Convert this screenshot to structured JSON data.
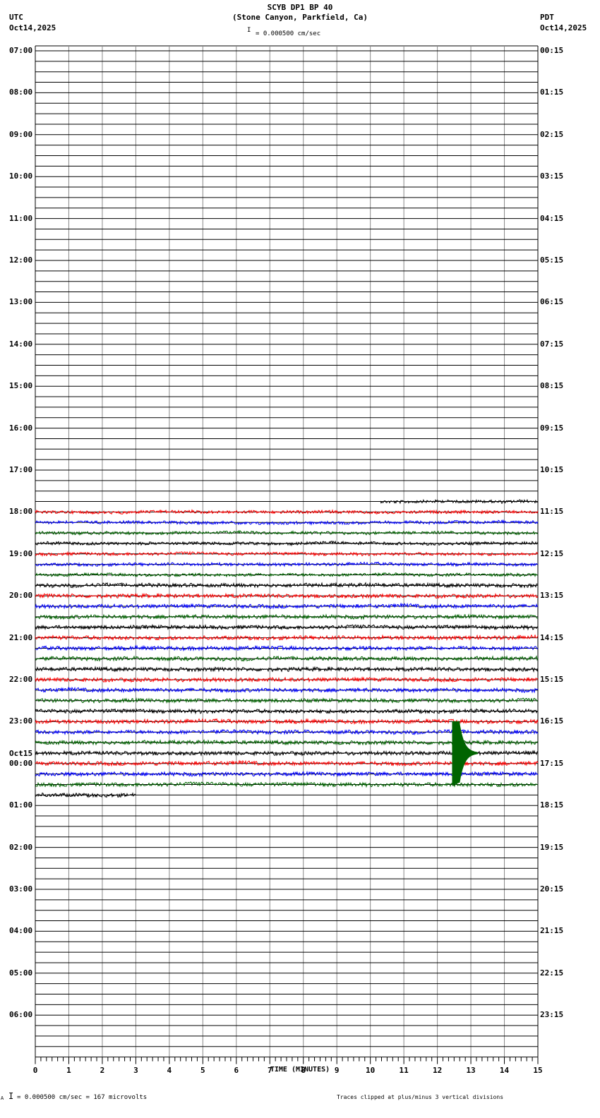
{
  "header": {
    "title": "SCYB DP1 BP 40",
    "subtitle": "(Stone Canyon, Parkfield, Ca)",
    "left_tz": "UTC",
    "left_date": "Oct14,2025",
    "right_tz": "PDT",
    "right_date": "Oct14,2025",
    "scale_text": "= 0.000500 cm/sec"
  },
  "footer": {
    "scale_text": "= 0.000500 cm/sec =     167 microvolts",
    "scale_prefix": "A",
    "clip_note": "Traces clipped at plus/minus 3 vertical divisions"
  },
  "chart_data": {
    "type": "line",
    "title": "SCYB DP1 BP 40",
    "xlabel": "TIME (MINUTES)",
    "xlim": [
      0,
      15
    ],
    "x_ticks": [
      "0",
      "1",
      "2",
      "3",
      "4",
      "5",
      "6",
      "7",
      "8",
      "9",
      "10",
      "11",
      "12",
      "13",
      "14",
      "15"
    ],
    "rows_per_hour": 4,
    "left_labels": [
      "07:00",
      "08:00",
      "09:00",
      "10:00",
      "11:00",
      "12:00",
      "13:00",
      "14:00",
      "15:00",
      "16:00",
      "17:00",
      "18:00",
      "19:00",
      "20:00",
      "21:00",
      "22:00",
      "23:00",
      "00:00",
      "01:00",
      "02:00",
      "03:00",
      "04:00",
      "05:00",
      "06:00"
    ],
    "left_date_change": {
      "label": "Oct15",
      "before": "00:00"
    },
    "right_labels": [
      "00:15",
      "01:15",
      "02:15",
      "03:15",
      "04:15",
      "05:15",
      "06:15",
      "07:15",
      "08:15",
      "09:15",
      "10:15",
      "11:15",
      "12:15",
      "13:15",
      "14:15",
      "15:15",
      "16:15",
      "17:15",
      "18:15",
      "19:15",
      "20:15",
      "21:15",
      "22:15",
      "23:15"
    ],
    "trace_colors": [
      "#000000",
      "#ff0000",
      "#0000ff",
      "#006400"
    ],
    "data_start": {
      "row_time": "17:45",
      "minute": 10.3
    },
    "data_end": {
      "row_time": "00:45",
      "minute": 3.0
    },
    "clip_divisions": 3,
    "event": {
      "row_time": "23:45",
      "minute_start": 12.45,
      "minute_peak_end": 12.65,
      "coda_end_minute": 13.2,
      "color": "#006400"
    }
  }
}
